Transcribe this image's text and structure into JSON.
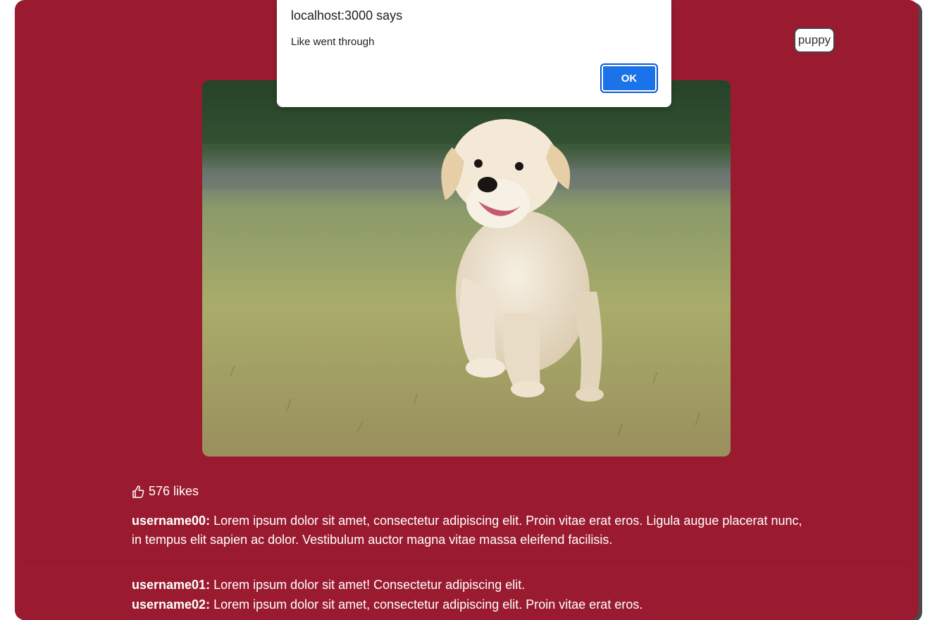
{
  "post": {
    "tag_label": "puppy",
    "likes_label": "576 likes",
    "comments": [
      {
        "user": "username00:",
        "text": " Lorem ipsum dolor sit amet, consectetur adipiscing elit. Proin vitae erat eros. Ligula augue placerat nunc, in tempus elit sapien ac dolor. Vestibulum auctor magna vitae massa eleifend facilisis."
      },
      {
        "user": "username01:",
        "text": " Lorem ipsum dolor sit amet! Consectetur adipiscing elit."
      },
      {
        "user": "username02:",
        "text": " Lorem ipsum dolor sit amet, consectetur adipiscing elit. Proin vitae erat eros."
      }
    ]
  },
  "dialog": {
    "title": "localhost:3000 says",
    "message": "Like went through",
    "ok_label": "OK"
  },
  "icons": {
    "like": "thumbs-up-icon"
  },
  "colors": {
    "card_background": "#9a1b2f",
    "dialog_button": "#1a73e8"
  }
}
